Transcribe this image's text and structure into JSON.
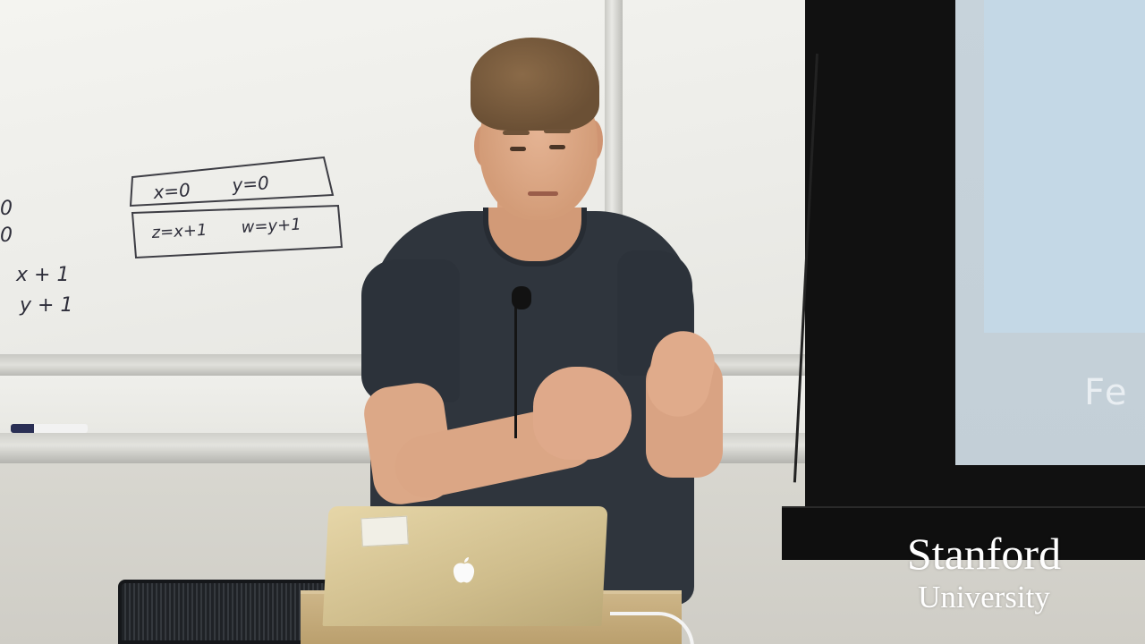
{
  "logo": {
    "line1": "Stanford",
    "line2": "University"
  },
  "whiteboard": {
    "box1_left": "x=0",
    "box1_right": "y=0",
    "box2_left": "z=x+1",
    "box2_right": "w=y+1",
    "left_col": [
      "0",
      "0",
      "x + 1",
      "y + 1"
    ]
  },
  "projection": {
    "partial_text": "Fe"
  },
  "colors": {
    "shirt": "#2f353d",
    "screen_blue": "#c4d8e6",
    "logo": "#ffffff"
  }
}
